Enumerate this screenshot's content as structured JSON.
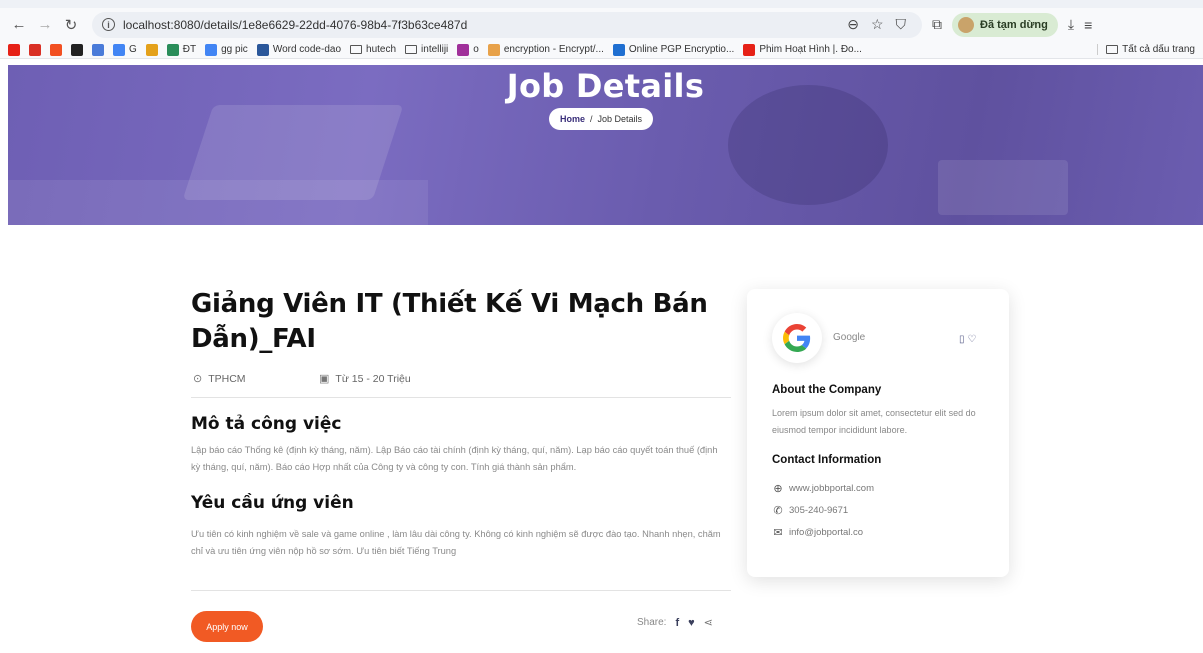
{
  "browser": {
    "url": "localhost:8080/details/1e8e6629-22dd-4076-98b4-7f3b63ce487d",
    "paused_label": "Đã tạm dừng",
    "bookmarks": [
      {
        "label": "",
        "icon": "youtube-icon",
        "color": "#e62117"
      },
      {
        "label": "",
        "icon": "gmail-icon",
        "color": "#d93025"
      },
      {
        "label": "",
        "icon": "microsoft-icon",
        "color": "#f25022"
      },
      {
        "label": "",
        "icon": "chatgpt-icon",
        "color": "#222222"
      },
      {
        "label": "",
        "icon": "bookmark-icon",
        "color": "#4a7bd9"
      },
      {
        "label": "G",
        "icon": "google-icon",
        "color": "#4285f4"
      },
      {
        "label": "",
        "icon": "bookmark-icon",
        "color": "#e4a11b"
      },
      {
        "label": "ĐT",
        "icon": "phone-icon",
        "color": "#2a8d5a"
      },
      {
        "label": "gg pic",
        "icon": "google-icon",
        "color": "#4285f4"
      },
      {
        "label": "Word code-dao",
        "icon": "word-icon",
        "color": "#2b579a"
      },
      {
        "label": "hutech",
        "icon": "folder-icon",
        "color": ""
      },
      {
        "label": "intelliji",
        "icon": "folder-icon",
        "color": ""
      },
      {
        "label": "o",
        "icon": "bookmark-icon",
        "color": "#a0309a"
      },
      {
        "label": "encryption - Encrypt/...",
        "icon": "bookmark-icon",
        "color": "#e8a24a"
      },
      {
        "label": "Online PGP Encryptio...",
        "icon": "bookmark-icon",
        "color": "#1f6fd1"
      },
      {
        "label": "Phim Hoạt Hình |. Đo...",
        "icon": "youtube-icon",
        "color": "#e62117"
      }
    ],
    "all_bookmarks_label": "Tất cả dấu trang"
  },
  "hero": {
    "title": "Job Details",
    "breadcrumb_home": "Home",
    "breadcrumb_sep": "/",
    "breadcrumb_current": "Job Details"
  },
  "job": {
    "title": "Giảng Viên IT (Thiết Kế Vi Mạch Bán Dẫn)_FAI",
    "location": "TPHCM",
    "salary": "Từ 15 - 20 Triệu",
    "description_heading": "Mô tả công việc",
    "description": "Lập báo cáo Thống kê (định kỳ tháng, năm). Lập Báo cáo tài chính (định kỳ tháng, quí, năm). Lạp báo cáo quyết toán thuế (định kỳ tháng, quí, năm). Báo cáo Hợp nhất của Công ty và công ty con. Tính giá thành sản phẩm.",
    "requirements_heading": "Yêu cầu ứng viên",
    "requirements": "Ưu tiên có kinh nghiệm về sale và game online , làm lâu dài công ty. Không có kinh nghiệm sẽ được đào tạo. Nhanh nhẹn, chăm chỉ và ưu tiên ứng viên nộp hồ sơ sớm. Ưu tiên biết Tiếng Trung",
    "apply_label": "Apply now",
    "share_label": "Share:"
  },
  "company": {
    "name": "Google",
    "about_heading": "About the Company",
    "about_text": "Lorem ipsum dolor sit amet, consectetur elit sed do eiusmod tempor incididunt labore.",
    "contact_heading": "Contact Information",
    "website": "www.jobbportal.com",
    "phone": "305-240-9671",
    "email": "info@jobportal.co"
  },
  "colors": {
    "accent": "#f15a24",
    "hero_overlay": "#6e5fb4"
  }
}
